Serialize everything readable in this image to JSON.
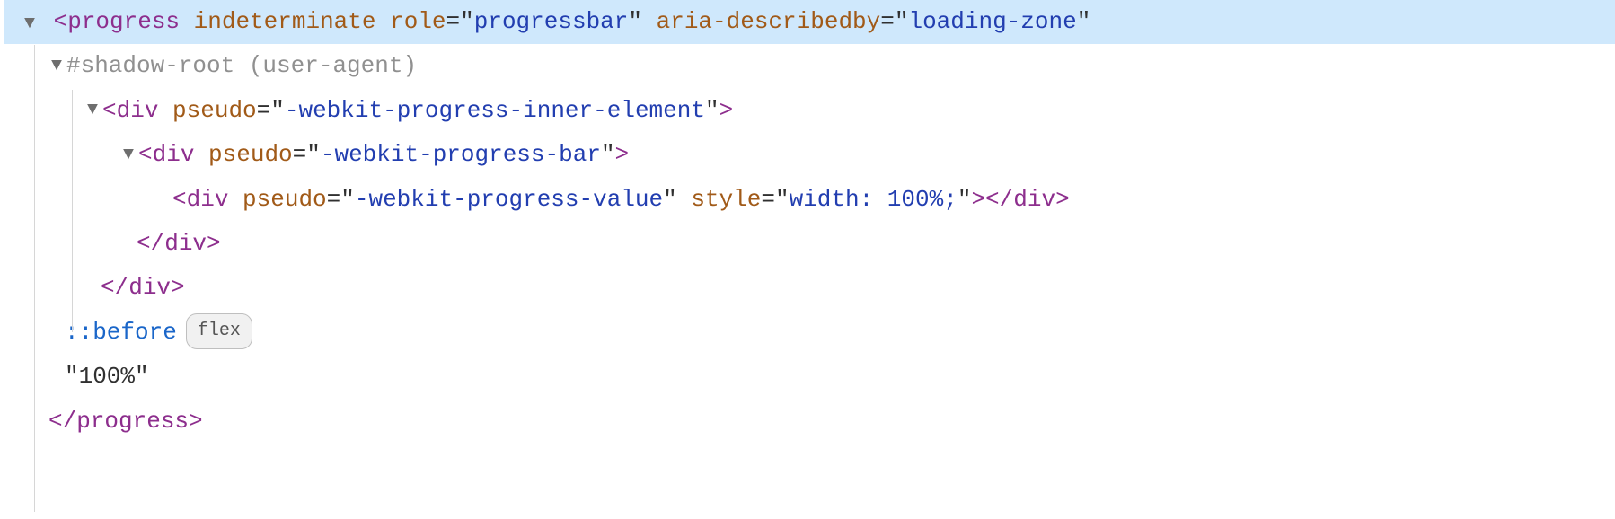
{
  "line1": {
    "tag": "progress",
    "attr1_name": "indeterminate",
    "attr2_name": "role",
    "attr2_val": "progressbar",
    "attr3_name": "aria-describedby",
    "attr3_val": "loading-zone"
  },
  "line2": {
    "text": "#shadow-root (user-agent)"
  },
  "line3": {
    "tag": "div",
    "attr1_name": "pseudo",
    "attr1_val": "-webkit-progress-inner-element"
  },
  "line4": {
    "tag": "div",
    "attr1_name": "pseudo",
    "attr1_val": "-webkit-progress-bar"
  },
  "line5": {
    "tag": "div",
    "attr1_name": "pseudo",
    "attr1_val": "-webkit-progress-value",
    "attr2_name": "style",
    "attr2_val": "width: 100%;",
    "close": "div"
  },
  "line6": {
    "close": "div"
  },
  "line7": {
    "close": "div"
  },
  "line8": {
    "pseudo": "::before",
    "badge": "flex"
  },
  "line9": {
    "text": "\"100%\""
  },
  "line10": {
    "close": "progress"
  }
}
